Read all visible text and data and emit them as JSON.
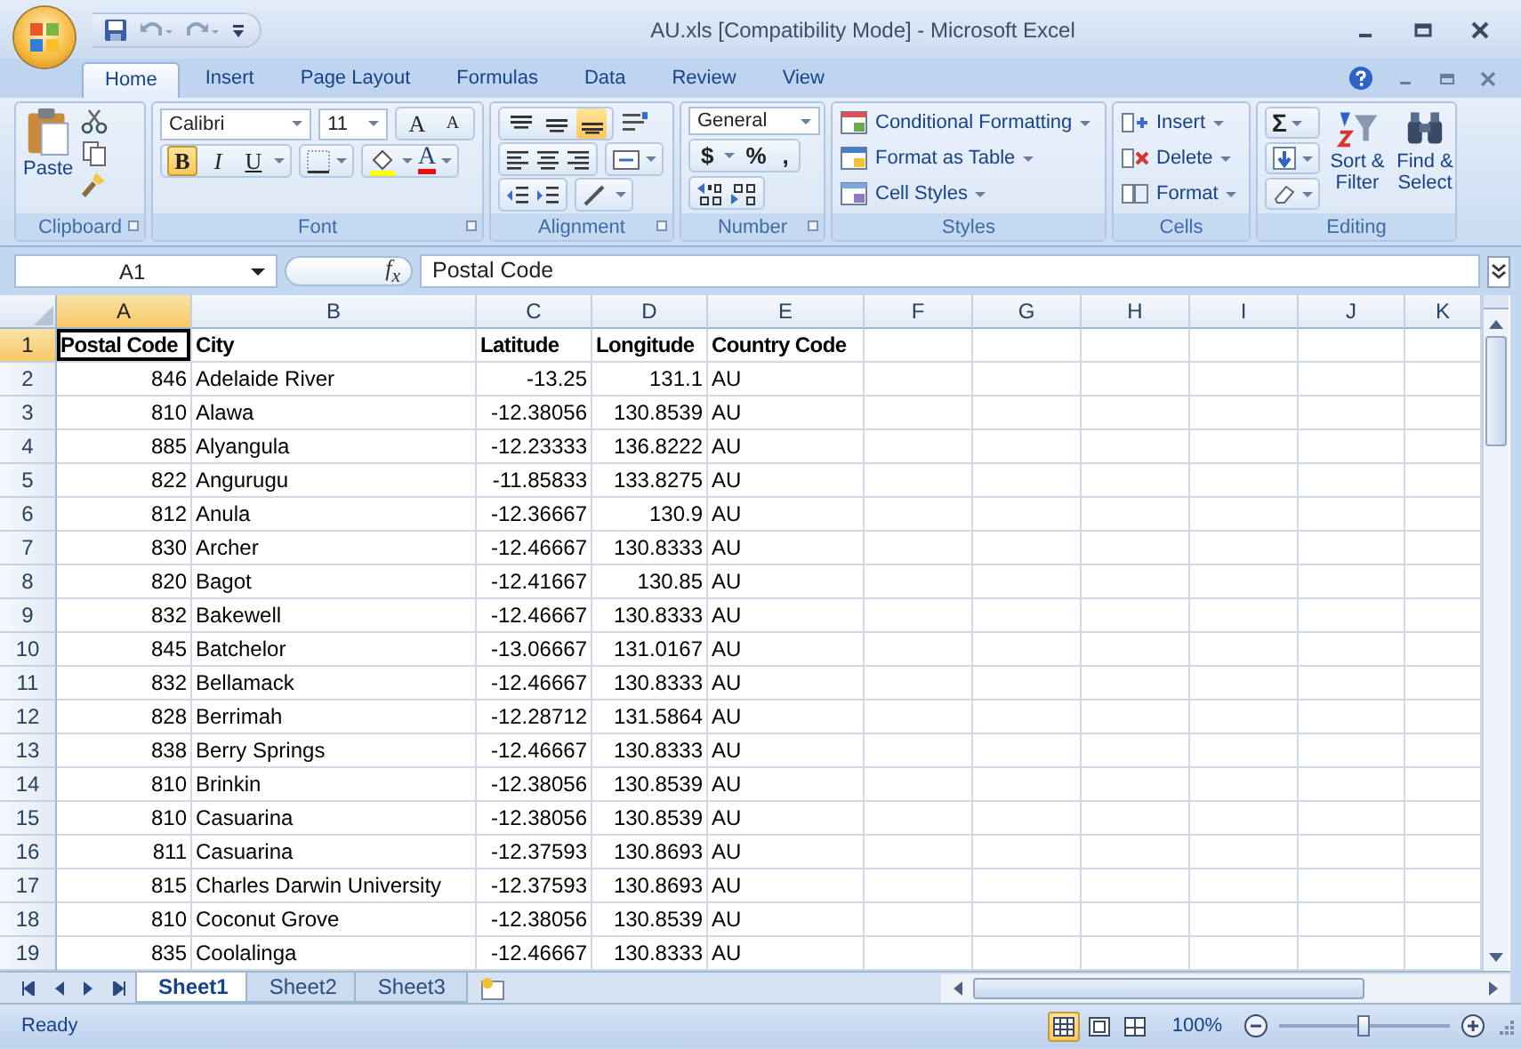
{
  "window": {
    "title": "AU.xls  [Compatibility Mode] - Microsoft Excel"
  },
  "tabs": [
    {
      "label": "Home",
      "selected": true
    },
    {
      "label": "Insert",
      "selected": false
    },
    {
      "label": "Page Layout",
      "selected": false
    },
    {
      "label": "Formulas",
      "selected": false
    },
    {
      "label": "Data",
      "selected": false
    },
    {
      "label": "Review",
      "selected": false
    },
    {
      "label": "View",
      "selected": false
    }
  ],
  "ribbon": {
    "clipboard": {
      "name": "Clipboard",
      "paste": "Paste"
    },
    "font": {
      "name": "Font",
      "family": "Calibri",
      "size": "11",
      "grow": "A",
      "shrink": "A",
      "color_letter": "A",
      "styles": [
        {
          "label": "B",
          "on": true
        },
        {
          "label": "I",
          "on": false
        },
        {
          "label": "U",
          "on": false
        }
      ]
    },
    "alignment": {
      "name": "Alignment",
      "vertical": [
        {
          "selected": false
        },
        {
          "selected": false
        },
        {
          "selected": true
        }
      ]
    },
    "number": {
      "name": "Number",
      "format": "General",
      "currency": "$",
      "percent": "%",
      "comma": ","
    },
    "styles": {
      "name": "Styles",
      "buttons": [
        "Conditional Formatting",
        "Format as Table",
        "Cell Styles"
      ]
    },
    "cells": {
      "name": "Cells",
      "buttons": [
        "Insert",
        "Delete",
        "Format"
      ]
    },
    "editing": {
      "name": "Editing",
      "sum": "Σ",
      "buttons": [
        "Sort & Filter",
        "Find & Select"
      ]
    }
  },
  "formula_bar": {
    "name_box": "A1",
    "fx": "f$_{x}$",
    "value": "Postal Code"
  },
  "sheet": {
    "columns": [
      {
        "label": "A",
        "selected": true
      },
      {
        "label": "B",
        "selected": false
      },
      {
        "label": "C",
        "selected": false
      },
      {
        "label": "D",
        "selected": false
      },
      {
        "label": "E",
        "selected": false
      },
      {
        "label": "F",
        "selected": false
      },
      {
        "label": "G",
        "selected": false
      },
      {
        "label": "H",
        "selected": false
      },
      {
        "label": "I",
        "selected": false
      },
      {
        "label": "J",
        "selected": false
      },
      {
        "label": "K",
        "selected": false
      }
    ],
    "rows": [
      {
        "number": "1",
        "kind": "header",
        "selected": true,
        "cells": [
          "Postal Code",
          "City",
          "Latitude",
          "Longitude",
          "Country Code"
        ]
      },
      {
        "number": "2",
        "kind": "data",
        "selected": false,
        "cells": [
          "846",
          "Adelaide River",
          "-13.25",
          "131.1",
          "AU"
        ]
      },
      {
        "number": "3",
        "kind": "data",
        "selected": false,
        "cells": [
          "810",
          "Alawa",
          "-12.38056",
          "130.8539",
          "AU"
        ]
      },
      {
        "number": "4",
        "kind": "data",
        "selected": false,
        "cells": [
          "885",
          "Alyangula",
          "-12.23333",
          "136.8222",
          "AU"
        ]
      },
      {
        "number": "5",
        "kind": "data",
        "selected": false,
        "cells": [
          "822",
          "Angurugu",
          "-11.85833",
          "133.8275",
          "AU"
        ]
      },
      {
        "number": "6",
        "kind": "data",
        "selected": false,
        "cells": [
          "812",
          "Anula",
          "-12.36667",
          "130.9",
          "AU"
        ]
      },
      {
        "number": "7",
        "kind": "data",
        "selected": false,
        "cells": [
          "830",
          "Archer",
          "-12.46667",
          "130.8333",
          "AU"
        ]
      },
      {
        "number": "8",
        "kind": "data",
        "selected": false,
        "cells": [
          "820",
          "Bagot",
          "-12.41667",
          "130.85",
          "AU"
        ]
      },
      {
        "number": "9",
        "kind": "data",
        "selected": false,
        "cells": [
          "832",
          "Bakewell",
          "-12.46667",
          "130.8333",
          "AU"
        ]
      },
      {
        "number": "10",
        "kind": "data",
        "selected": false,
        "cells": [
          "845",
          "Batchelor",
          "-13.06667",
          "131.0167",
          "AU"
        ]
      },
      {
        "number": "11",
        "kind": "data",
        "selected": false,
        "cells": [
          "832",
          "Bellamack",
          "-12.46667",
          "130.8333",
          "AU"
        ]
      },
      {
        "number": "12",
        "kind": "data",
        "selected": false,
        "cells": [
          "828",
          "Berrimah",
          "-12.28712",
          "131.5864",
          "AU"
        ]
      },
      {
        "number": "13",
        "kind": "data",
        "selected": false,
        "cells": [
          "838",
          "Berry Springs",
          "-12.46667",
          "130.8333",
          "AU"
        ]
      },
      {
        "number": "14",
        "kind": "data",
        "selected": false,
        "cells": [
          "810",
          "Brinkin",
          "-12.38056",
          "130.8539",
          "AU"
        ]
      },
      {
        "number": "15",
        "kind": "data",
        "selected": false,
        "cells": [
          "810",
          "Casuarina",
          "-12.38056",
          "130.8539",
          "AU"
        ]
      },
      {
        "number": "16",
        "kind": "data",
        "selected": false,
        "cells": [
          "811",
          "Casuarina",
          "-12.37593",
          "130.8693",
          "AU"
        ]
      },
      {
        "number": "17",
        "kind": "data",
        "selected": false,
        "cells": [
          "815",
          "Charles Darwin University",
          "-12.37593",
          "130.8693",
          "AU"
        ]
      },
      {
        "number": "18",
        "kind": "data",
        "selected": false,
        "cells": [
          "810",
          "Coconut Grove",
          "-12.38056",
          "130.8539",
          "AU"
        ]
      },
      {
        "number": "19",
        "kind": "data",
        "selected": false,
        "cells": [
          "835",
          "Coolalinga",
          "-12.46667",
          "130.8333",
          "AU"
        ]
      }
    ]
  },
  "sheet_tabs": [
    {
      "label": "Sheet1",
      "selected": true
    },
    {
      "label": "Sheet2",
      "selected": false
    },
    {
      "label": "Sheet3",
      "selected": false
    }
  ],
  "status_bar": {
    "text": "Ready",
    "views": [
      {
        "selected": true
      },
      {
        "selected": false
      },
      {
        "selected": false
      }
    ],
    "zoom": "100%",
    "zoom_level": {
      "level": 0.5
    }
  }
}
